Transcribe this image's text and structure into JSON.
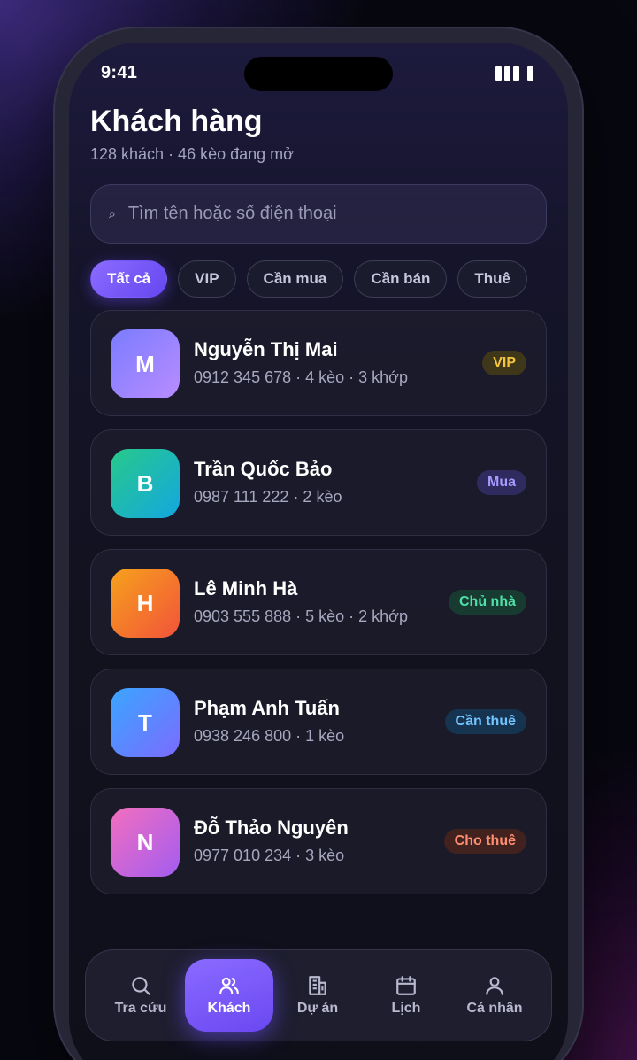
{
  "status": {
    "time": "9:41"
  },
  "header": {
    "title": "Khách hàng",
    "subtitle": "128 khách · 46 kèo đang mở"
  },
  "search": {
    "placeholder": "Tìm tên hoặc số điện thoại",
    "icon": "search-icon"
  },
  "filters": [
    {
      "label": "Tất cả",
      "active": true
    },
    {
      "label": "VIP",
      "active": false
    },
    {
      "label": "Cần mua",
      "active": false
    },
    {
      "label": "Cần bán",
      "active": false
    },
    {
      "label": "Thuê",
      "active": false
    }
  ],
  "customers": [
    {
      "initial": "M",
      "name": "Nguyễn Thị Mai",
      "meta": "0912 345 678 · 4 kèo · 3 khớp",
      "badge": "VIP",
      "avatar_colors": [
        "#7a7cff",
        "#b98cff"
      ],
      "badge_bg": "#3f3719",
      "badge_color": "#f5c53c"
    },
    {
      "initial": "B",
      "name": "Trần Quốc Bảo",
      "meta": "0987 111 222 · 2 kèo",
      "badge": "Mua",
      "avatar_colors": [
        "#28c98a",
        "#13a7e0"
      ],
      "badge_bg": "#2f2b5e",
      "badge_color": "#a89aff"
    },
    {
      "initial": "H",
      "name": "Lê Minh Hà",
      "meta": "0903 555 888 · 5 kèo · 2 khớp",
      "badge": "Chủ nhà",
      "avatar_colors": [
        "#f6a21c",
        "#f2533a"
      ],
      "badge_bg": "#173b31",
      "badge_color": "#4fe0a8"
    },
    {
      "initial": "T",
      "name": "Phạm Anh Tuấn",
      "meta": "0938 246 800 · 1 kèo",
      "badge": "Cần thuê",
      "avatar_colors": [
        "#3aa6ff",
        "#7b6bff"
      ],
      "badge_bg": "#163450",
      "badge_color": "#72c4ff"
    },
    {
      "initial": "N",
      "name": "Đỗ Thảo Nguyên",
      "meta": "0977 010 234 · 3 kèo",
      "badge": "Cho thuê",
      "avatar_colors": [
        "#f26fbf",
        "#a35cf0"
      ],
      "badge_bg": "#42221f",
      "badge_color": "#ff8f70"
    }
  ],
  "tabs": [
    {
      "label": "Tra cứu",
      "icon": "search-icon",
      "active": false
    },
    {
      "label": "Khách",
      "icon": "users-icon",
      "active": true
    },
    {
      "label": "Dự án",
      "icon": "building-icon",
      "active": false
    },
    {
      "label": "Lịch",
      "icon": "calendar-icon",
      "active": false
    },
    {
      "label": "Cá nhân",
      "icon": "person-icon",
      "active": false
    }
  ],
  "colors": {
    "accent": "#7a5cff"
  }
}
